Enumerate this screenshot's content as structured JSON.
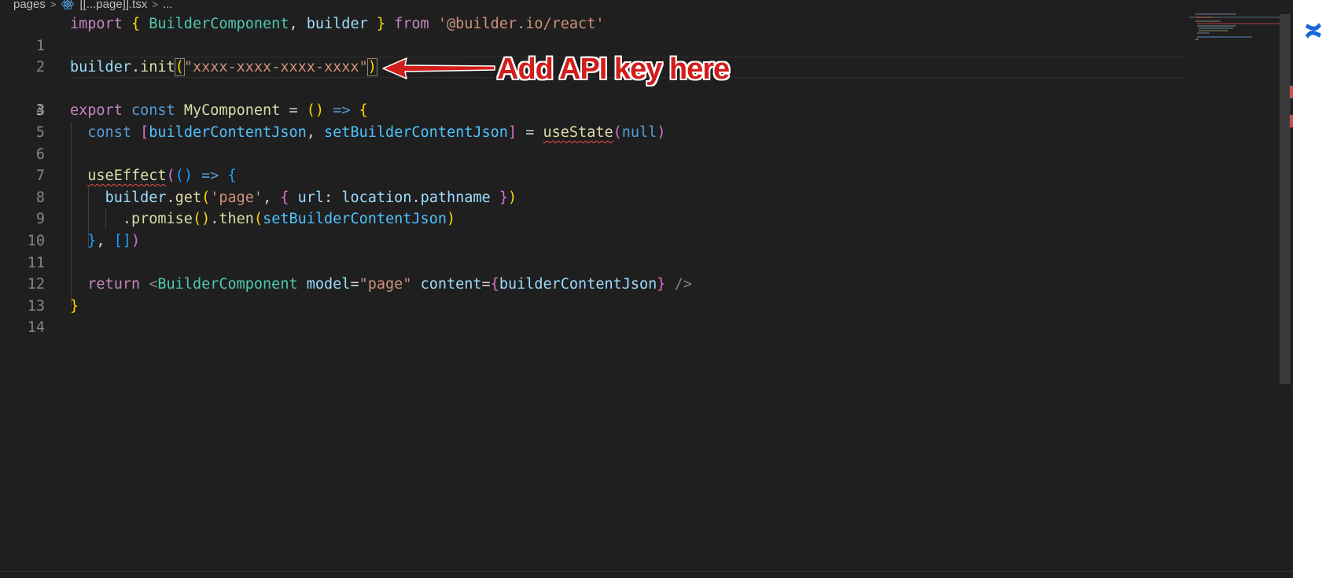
{
  "breadcrumb": {
    "folder": "pages",
    "file": "[[...page]].tsx",
    "more": "..."
  },
  "code": {
    "line_numbers": [
      "1",
      "2",
      "3",
      "4",
      "5",
      "6",
      "7",
      "8",
      "9",
      "10",
      "11",
      "12",
      "13",
      "14"
    ],
    "tokens": {
      "import": "import",
      "brace_open": "{",
      "brace_close": "}",
      "BuilderComponent": "BuilderComponent",
      "comma": ",",
      "builder": "builder",
      "from": "from",
      "module": "'@builder.io/react'",
      "dot": ".",
      "init": "init",
      "paren_open": "(",
      "paren_close": ")",
      "api_key": "\"xxxx-xxxx-xxxx-xxxx\"",
      "export": "export",
      "const": "const",
      "MyComponent": "MyComponent",
      "equals": "=",
      "arrow": "=>",
      "bracket_open": "[",
      "bracket_close": "]",
      "builderContentJson": "builderContentJson",
      "setBuilderContentJson": "setBuilderContentJson",
      "useState": "useState",
      "null": "null",
      "useEffect": "useEffect",
      "get": "get",
      "page_str": "'page'",
      "url": "url",
      "colon": ":",
      "location": "location",
      "pathname": "pathname",
      "promise": "promise",
      "then": "then",
      "return": "return",
      "lt": "<",
      "model": "model",
      "page_dq": "\"page\"",
      "content": "content",
      "selfclose": "/>"
    }
  },
  "annotation": {
    "text": "Add API key here",
    "color": "#d21d1d"
  },
  "colors": {
    "editor_bg": "#1f1f1f",
    "keyword": "#c586c0",
    "storage": "#569cd6",
    "variable": "#9cdcfe",
    "function": "#dcdcaa",
    "string": "#ce9178",
    "type": "#4ec9b0"
  },
  "icons": {
    "file_icon": "react-icon",
    "side_icon": "confluence-icon"
  }
}
